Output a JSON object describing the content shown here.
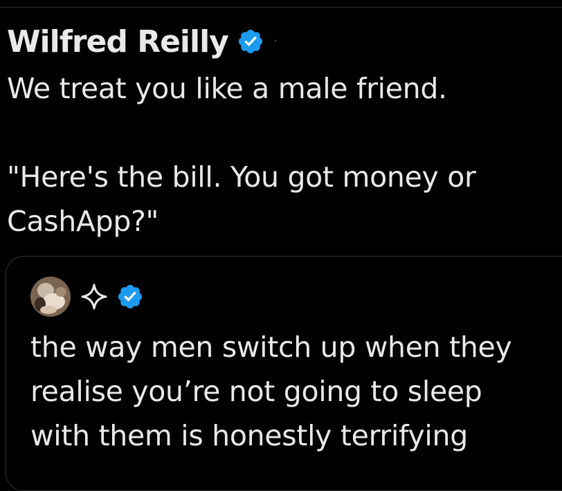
{
  "tweet": {
    "author_name": "Wilfred Reilly",
    "separator": "·",
    "text": "We treat you like a male friend.\n\n\"Here's the bill. You got money or\nCashApp?\""
  },
  "quote_tweet": {
    "text": "the way men switch up when they\nrealise you’re not going to sleep\nwith them is honestly terrifying"
  },
  "icons": {
    "verified": "verified-badge-icon",
    "sparkle": "sparkle-icon",
    "avatar": "avatar"
  },
  "colors": {
    "background": "#000000",
    "text": "#e7e9ea",
    "verified_blue": "#1d9bf0",
    "border": "#2f3336",
    "muted": "#71767b"
  }
}
